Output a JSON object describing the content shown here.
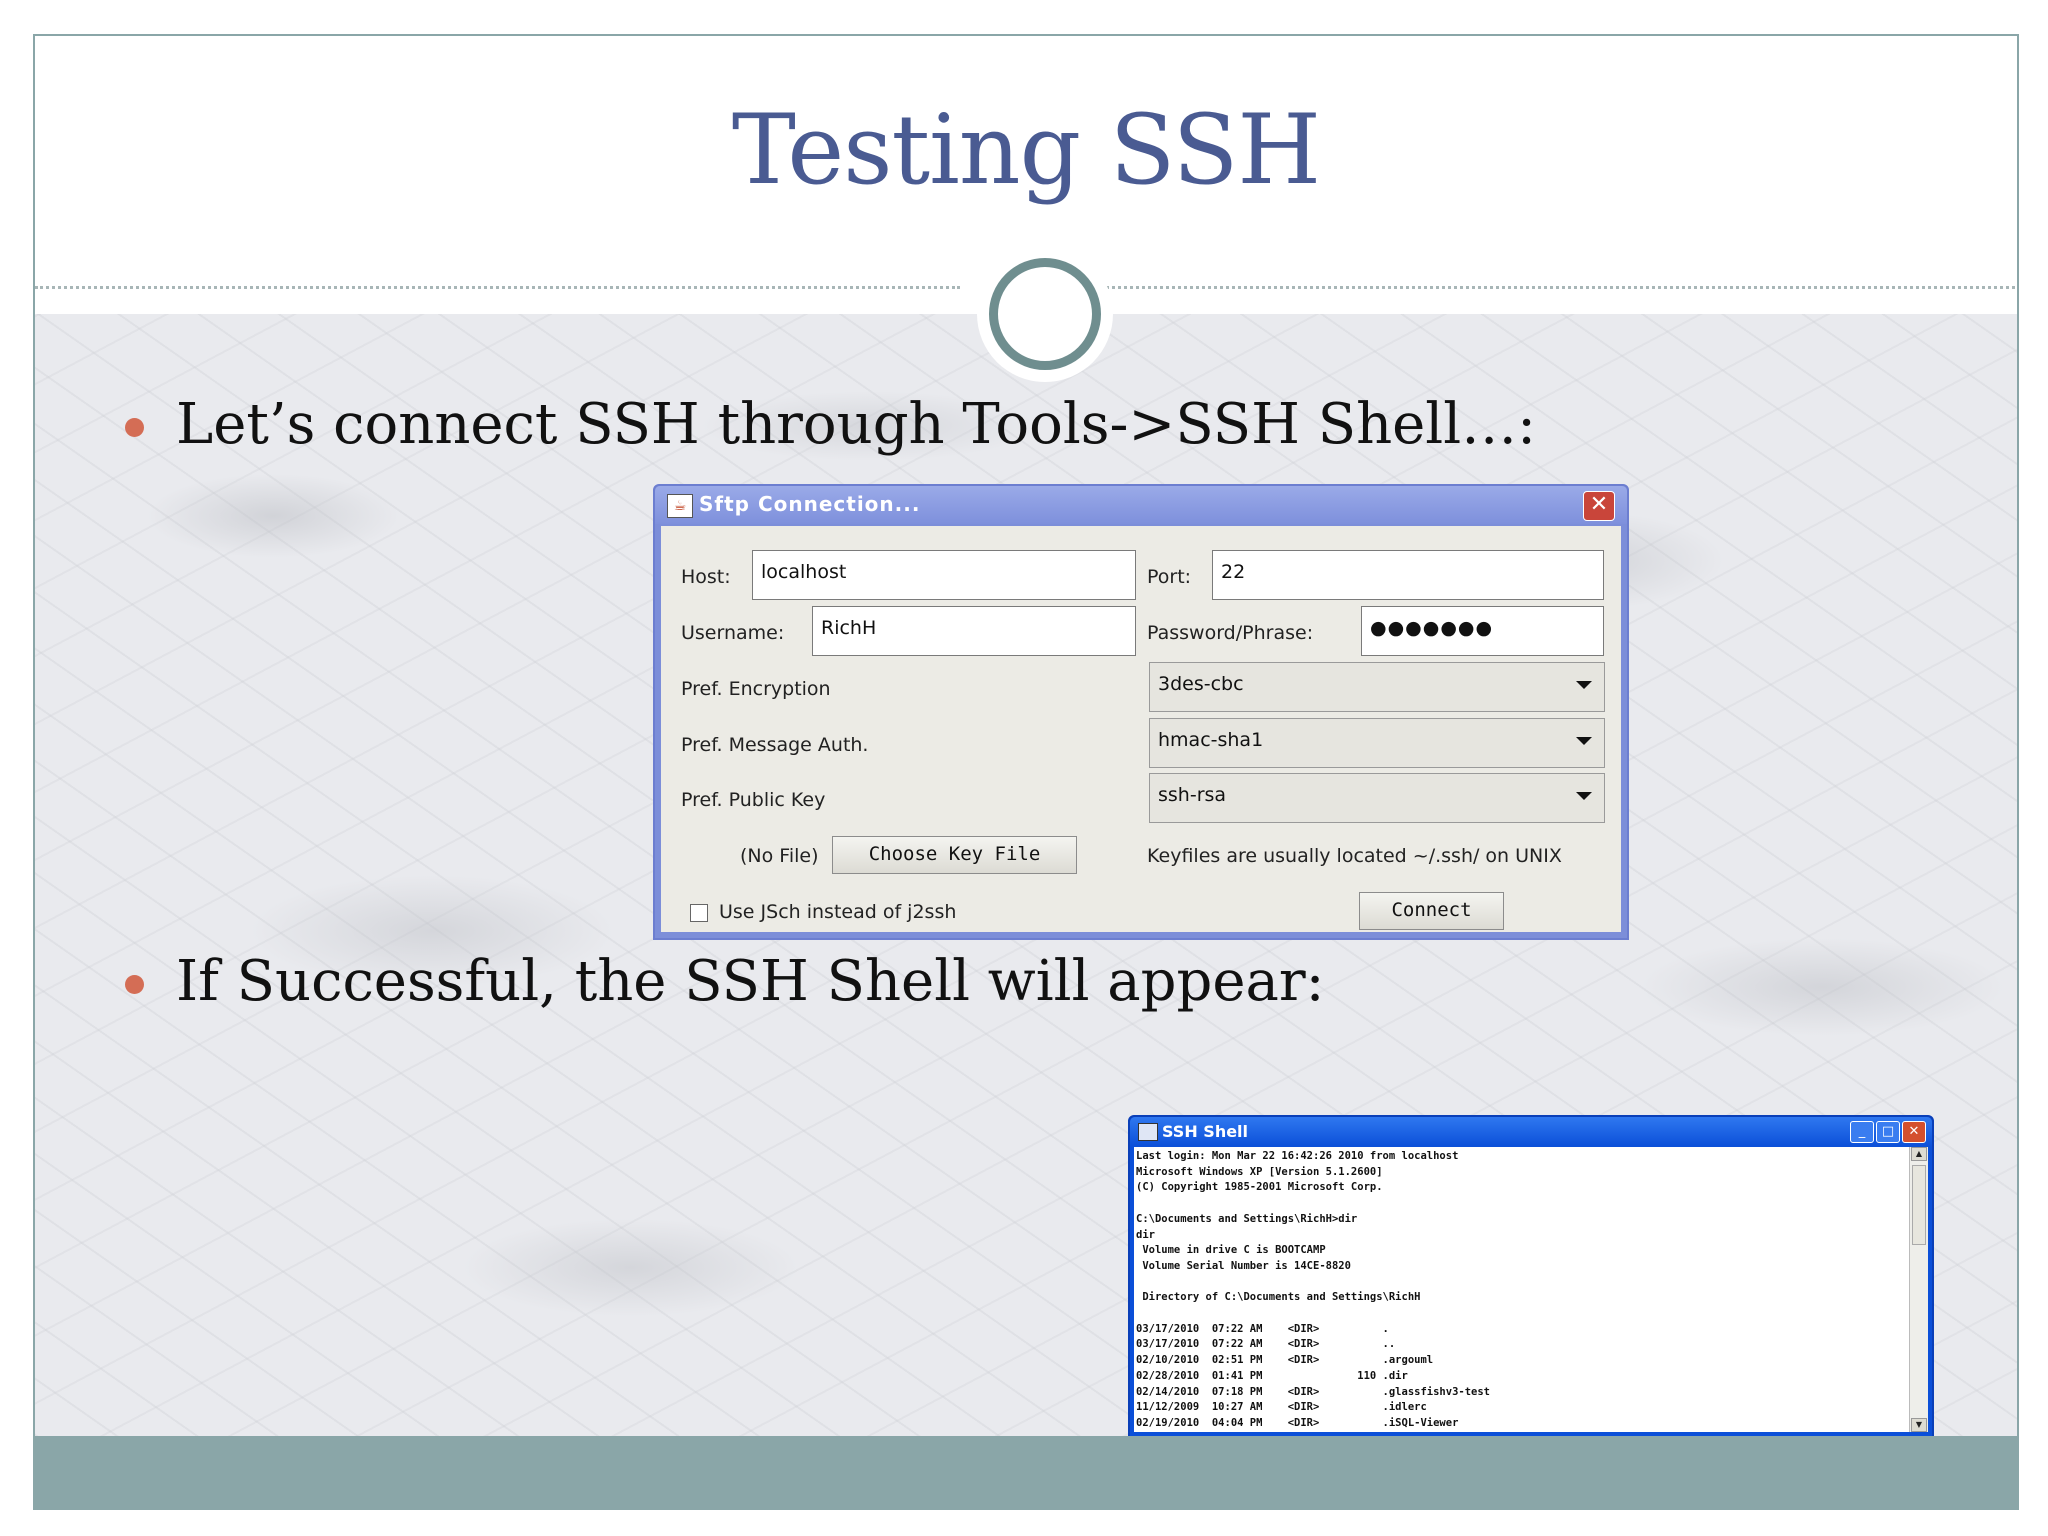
{
  "slide": {
    "title": "Testing SSH",
    "bullet1": "Let’s connect SSH through Tools->SSH Shell…:",
    "bullet2": "If Successful, the SSH Shell will appear:"
  },
  "sftp_dialog": {
    "title": "Sftp Connection...",
    "close_icon": "✕",
    "host_label": "Host:",
    "host_value": "localhost",
    "port_label": "Port:",
    "port_value": "22",
    "username_label": "Username:",
    "username_value": "RichH",
    "password_label": "Password/Phrase:",
    "password_value": "●●●●●●●",
    "encryption_label": "Pref. Encryption",
    "encryption_value": "3des-cbc",
    "message_auth_label": "Pref. Message Auth.",
    "message_auth_value": "hmac-sha1",
    "public_key_label": "Pref. Public Key",
    "public_key_value": "ssh-rsa",
    "no_file_label": "(No File)",
    "choose_key_button": "Choose Key File",
    "keyfiles_hint": "Keyfiles are usually located ~/.ssh/ on UNIX",
    "jsch_checkbox_label": "Use JSch instead of j2ssh",
    "connect_button": "Connect"
  },
  "ssh_shell": {
    "title": "SSH Shell",
    "minimize": "_",
    "maximize": "□",
    "close": "✕",
    "scroll_up": "▲",
    "scroll_down": "▼",
    "terminal_text": "Last login: Mon Mar 22 16:42:26 2010 from localhost\nMicrosoft Windows XP [Version 5.1.2600]\n(C) Copyright 1985-2001 Microsoft Corp.\n\nC:\\Documents and Settings\\RichH>dir\ndir\n Volume in drive C is BOOTCAMP\n Volume Serial Number is 14CE-8820\n\n Directory of C:\\Documents and Settings\\RichH\n\n03/17/2010  07:22 AM    <DIR>          .\n03/17/2010  07:22 AM    <DIR>          ..\n02/10/2010  02:51 PM    <DIR>          .argouml\n02/28/2010  01:41 PM               110 .dir\n02/14/2010  07:18 PM    <DIR>          .glassfishv3-test\n11/12/2009  10:27 AM    <DIR>          .idlerc\n02/19/2010  04:04 PM    <DIR>          .iSQL-Viewer"
  },
  "colors": {
    "title": "#4a5b92",
    "bullet": "#d46d55",
    "accent": "#8aa6a8",
    "dialog_title": "#7e90dc",
    "ssh_title": "#0b4fd8"
  }
}
